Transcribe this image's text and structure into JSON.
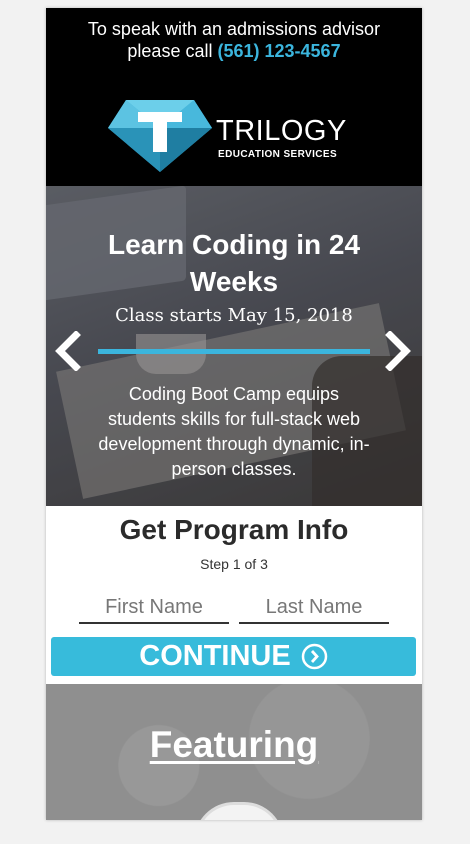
{
  "header": {
    "call_line1": "To speak with an admissions advisor",
    "call_line2": "please call",
    "phone": "(561) 123-4567",
    "logo_name": "TRILOGY",
    "logo_sub": "EDUCATION SERVICES"
  },
  "hero": {
    "title_line1": "Learn Coding in 24",
    "title_line2": "Weeks",
    "date": "Class starts May 15, 2018",
    "description": "Coding Boot Camp equips students skills for full-stack web development through dynamic, in-person classes.",
    "icons": {
      "prev": "chevron-left-icon",
      "next": "chevron-right-icon"
    }
  },
  "form": {
    "title": "Get Program Info",
    "step": "Step 1 of 3",
    "first_name_placeholder": "First Name",
    "last_name_placeholder": "Last Name",
    "continue_label": "CONTINUE"
  },
  "featuring": {
    "title": "Featuring"
  },
  "colors": {
    "accent": "#37bbdb",
    "phone": "#3bb5dd",
    "header_bg": "#000000",
    "featuring_bg": "#8f8f8f"
  }
}
